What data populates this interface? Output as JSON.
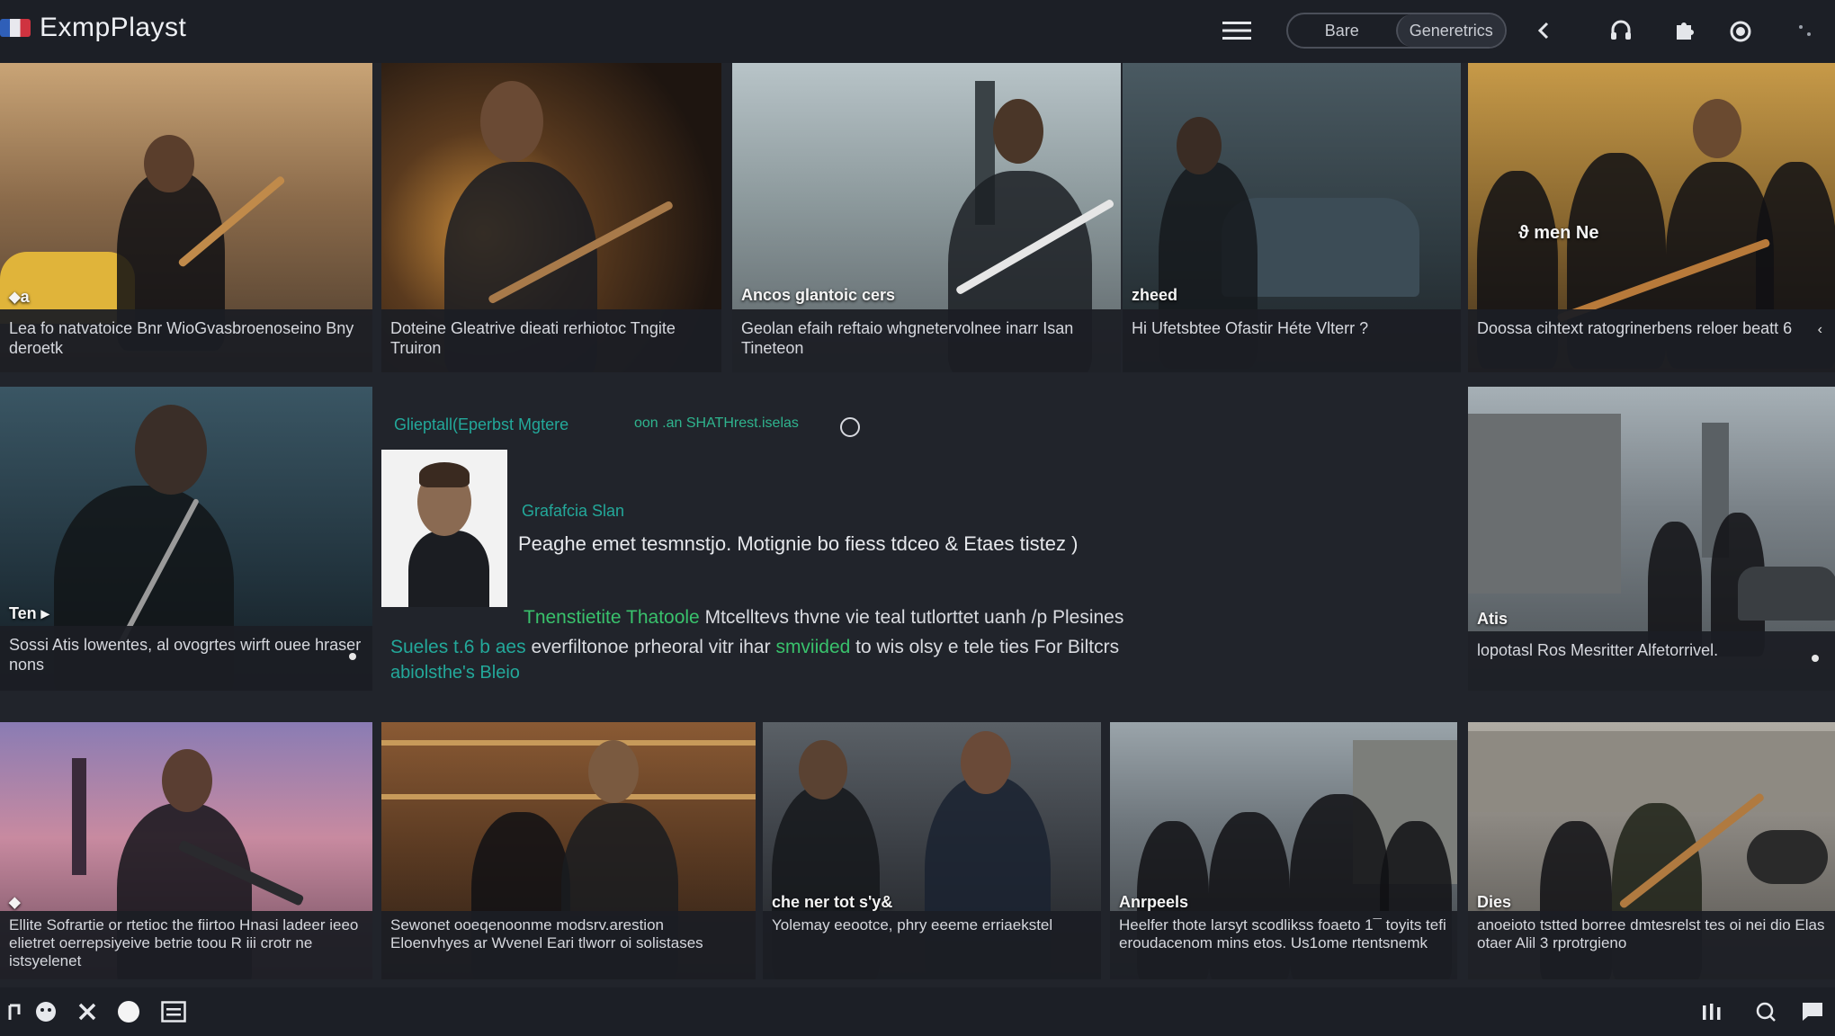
{
  "app": {
    "title": "ExmpPlayst"
  },
  "header": {
    "segments": [
      "Bare",
      "Generetrics"
    ]
  },
  "tiles_row1": [
    {
      "tag": "⬥a",
      "caption": "Lea fo natvatoice Bnr WioGvasbroenoseino Bny deroetk"
    },
    {
      "tag": "",
      "caption": "Doteine Gleatrive dieati rerhiotoc Tngite Truiron"
    },
    {
      "tag": "Ancos glantoic cers",
      "caption": "Geolan efaih reftaio whgnetervolnee inarr Isan Tineteon"
    },
    {
      "tag": "zheed",
      "caption": "Hi Ufetsbtee Ofastir Héte Vlterr ?"
    },
    {
      "tag": "",
      "overlay": "ϑ men     Ne",
      "caption": "Doossa cihtext ratogrinerbens reloer beatt 6"
    }
  ],
  "tiles_row2": [
    {
      "tag": "Ten ▸",
      "caption": "Sossi Atis lowentes, al ovogrtes wirft ouee hraser nons"
    },
    {
      "tag": "Atis",
      "caption": "lopotasl Ros Mesritter Alfetorrivel."
    }
  ],
  "detail": {
    "breadcrumb": "Glieptall(Eperbst Mgtere",
    "breadcrumb2": "oon  .an  SHATHrest.iselas",
    "name": "Grafafcia Slan",
    "description": "Peaghe emet tesmnstjo. Motignie bo fiess tdceo & Etaes tistez )",
    "line1_highlight": "Tnenstietite Thatoole",
    "line1_text": "Mtcelltevs thvne vie teal tutlorttet uanh /p Plesines",
    "line2_highlight": "Sueles t.6 b aes",
    "line2_text_a": "everfiltonoe prheoral vitr ihar",
    "line2_green": "smviided",
    "line2_text_b": "to wis olsy e tele ties For Biltcrs",
    "line3": "abiolsthe's Bleio"
  },
  "tiles_row3": [
    {
      "tag": "⬥",
      "caption": "Ellite Sofrartie or rtetioc the fiirtoo Hnasi ladeer ieeo elietret oerrepsiyeive betrie toou R iii crotr ne istsyelenet"
    },
    {
      "tag": "",
      "caption": "Sewonet ooeqenoonme modsrv.arestion Eloenvhyes ar Wvenel Eari tlworr oi solistases"
    },
    {
      "tag": "che ner tot s'y&",
      "caption": "Yolemay eeootce, phry eeeme erriaekstel"
    },
    {
      "tag": "Anrpeels",
      "caption": "Heelfer thote larsyt scodlikss foaeto 1¯ toyits tefi eroudacenom mins etos. Us1ome rtentsnemk"
    },
    {
      "tag": "Dies",
      "caption": "anoeioto tstted borree dmtesrelst tes oi nei dio Elas otaer Alil 3 rprotrgieno"
    }
  ],
  "colors": {
    "background": "#21242b",
    "bar": "#1c1f26",
    "accent_teal": "#23a89a",
    "accent_green": "#39c16c"
  },
  "icons": {
    "top": [
      "menu-icon",
      "back-icon",
      "headphones-icon",
      "puzzle-icon",
      "power-icon",
      "settings-icon"
    ],
    "bottom_left": [
      "cup-icon",
      "face-icon",
      "close-icon",
      "circle-icon",
      "list-icon"
    ],
    "bottom_right": [
      "equalizer-icon",
      "search-icon",
      "chat-icon"
    ]
  }
}
